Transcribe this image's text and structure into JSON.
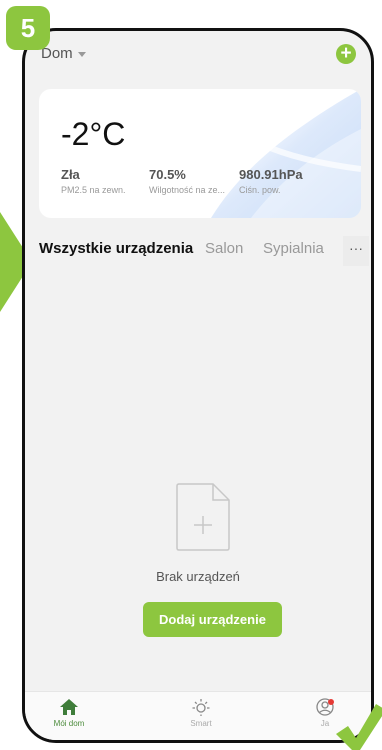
{
  "step_badge": "5",
  "header": {
    "home_name": "Dom",
    "add_icon": "plus-circle-icon"
  },
  "weather": {
    "temperature": "-2°C",
    "stats": [
      {
        "value": "Zła",
        "label": "PM2.5 na zewn."
      },
      {
        "value": "70.5%",
        "label": "Wilgotność na ze..."
      },
      {
        "value": "980.91hPa",
        "label": "Ciśn. pow."
      }
    ]
  },
  "tabs": [
    "Wszystkie urządzenia",
    "Salon",
    "Sypialnia"
  ],
  "more_label": "···",
  "empty_state": {
    "message": "Brak urządzeń",
    "button_label": "Dodaj urządzenie"
  },
  "bottom_nav": [
    {
      "label": "Mói dom",
      "icon": "home-icon"
    },
    {
      "label": "Smart",
      "icon": "sun-icon"
    },
    {
      "label": "Ja",
      "icon": "user-icon"
    }
  ],
  "colors": {
    "accent": "#8dc63f",
    "background": "#f2f2f2",
    "active_nav": "#4b8b3b",
    "notification": "#e53935"
  }
}
